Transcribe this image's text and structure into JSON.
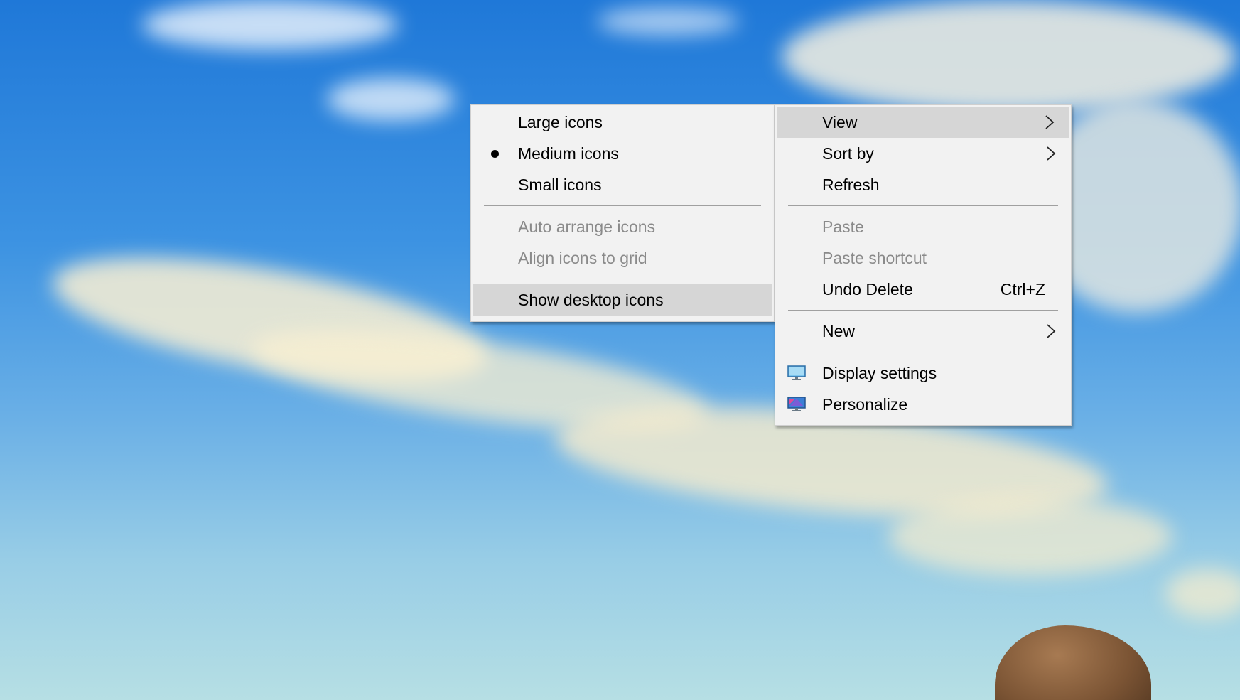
{
  "view_submenu": {
    "items": [
      {
        "label": "Large icons",
        "checked": false,
        "enabled": true
      },
      {
        "label": "Medium icons",
        "checked": true,
        "enabled": true
      },
      {
        "label": "Small icons",
        "checked": false,
        "enabled": true
      },
      {
        "label": "Auto arrange icons",
        "enabled": false
      },
      {
        "label": "Align icons to grid",
        "enabled": false
      },
      {
        "label": "Show desktop icons",
        "enabled": true,
        "highlighted": true
      }
    ]
  },
  "context_menu": {
    "items": [
      {
        "label": "View",
        "submenu": true,
        "highlighted": true
      },
      {
        "label": "Sort by",
        "submenu": true
      },
      {
        "label": "Refresh"
      },
      {
        "label": "Paste",
        "enabled": false
      },
      {
        "label": "Paste shortcut",
        "enabled": false
      },
      {
        "label": "Undo Delete",
        "shortcut": "Ctrl+Z"
      },
      {
        "label": "New",
        "submenu": true
      },
      {
        "label": "Display settings",
        "icon": "display-settings-icon"
      },
      {
        "label": "Personalize",
        "icon": "personalize-icon"
      }
    ]
  },
  "colors": {
    "menu_bg": "#f2f2f2",
    "highlight_bg": "#d6d6d6",
    "disabled_text": "#8a8a8a"
  }
}
